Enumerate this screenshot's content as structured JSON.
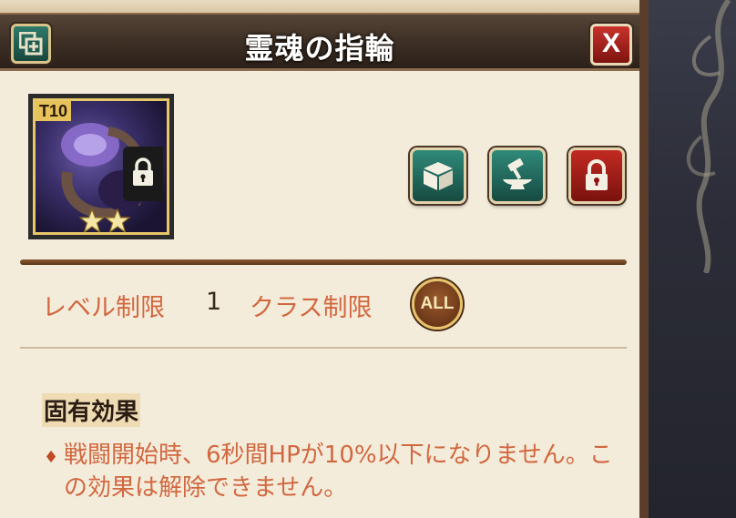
{
  "dialog": {
    "title": "霊魂の指輪",
    "close_label": "X"
  },
  "item": {
    "tier": "T10",
    "stars": 2,
    "locked": true
  },
  "requirements": {
    "level_label": "レベル制限",
    "level_value": "1",
    "class_label": "クラス制限",
    "class_value": "ALL"
  },
  "effect": {
    "heading": "固有効果",
    "bullet": "♦",
    "text": "戦闘開始時、6秒間HPが10%以下になりません。この効果は解除できません。"
  },
  "icons": {
    "add": "add-icon",
    "close": "close-icon",
    "storage": "box-icon",
    "enhance": "anvil-hammer-icon",
    "lock": "lock-icon"
  },
  "colors": {
    "label": "#d1673f",
    "panel": "#f4ecdb",
    "header": "#3a2c22",
    "green_button": "#1f6b5e",
    "red_button": "#a51c17",
    "gold": "#e7c26b"
  }
}
